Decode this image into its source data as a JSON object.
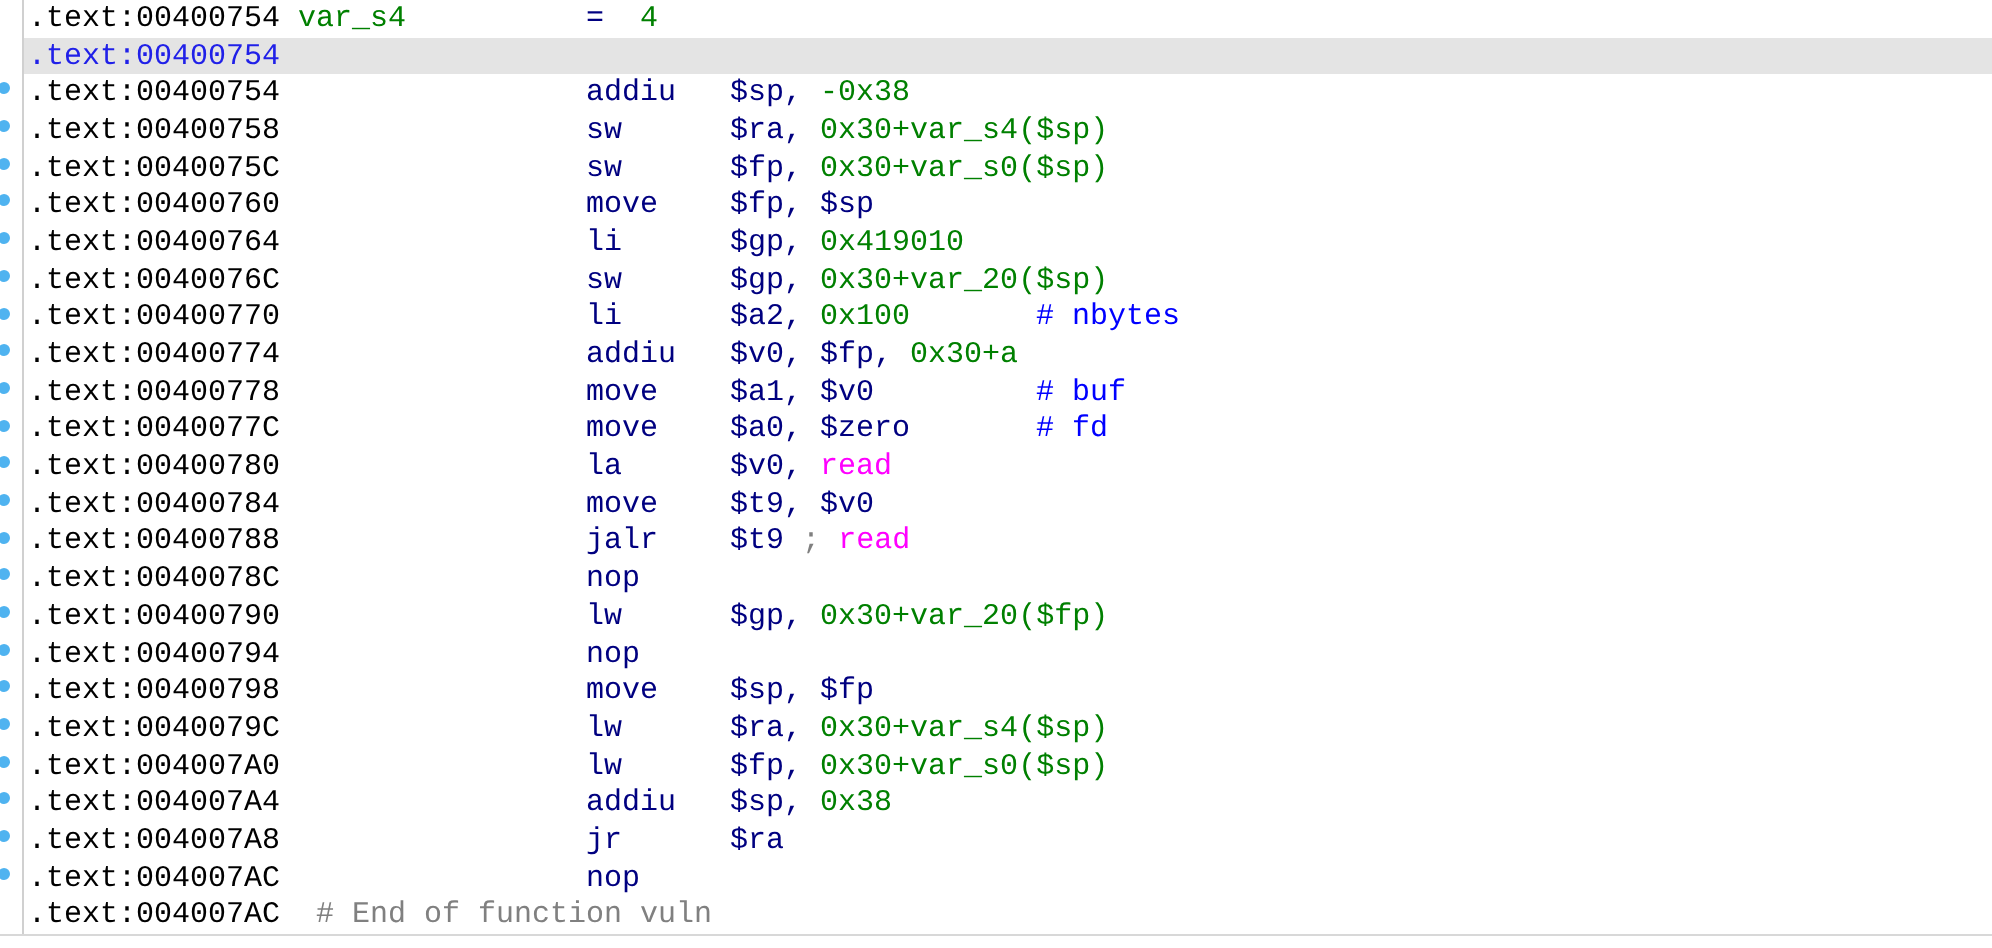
{
  "rows": [
    {
      "kind": "stackvar",
      "address": ".text:00400754",
      "selected": false,
      "name": "var_s4",
      "operator": "=",
      "value": "4"
    },
    {
      "kind": "label",
      "address": ".text:00400754",
      "selected": true
    },
    {
      "kind": "instruction",
      "address": ".text:00400754",
      "selected": false,
      "mnemonic": "addiu",
      "operands": [
        {
          "text": "$sp, ",
          "kind": "reg"
        },
        {
          "text": "-0x38",
          "kind": "num"
        }
      ]
    },
    {
      "kind": "instruction",
      "address": ".text:00400758",
      "selected": false,
      "mnemonic": "sw",
      "operands": [
        {
          "text": "$ra, ",
          "kind": "reg"
        },
        {
          "text": "0x30+var_s4($sp)",
          "kind": "num"
        }
      ]
    },
    {
      "kind": "instruction",
      "address": ".text:0040075C",
      "selected": false,
      "mnemonic": "sw",
      "operands": [
        {
          "text": "$fp, ",
          "kind": "reg"
        },
        {
          "text": "0x30+var_s0($sp)",
          "kind": "num"
        }
      ]
    },
    {
      "kind": "instruction",
      "address": ".text:00400760",
      "selected": false,
      "mnemonic": "move",
      "operands": [
        {
          "text": "$fp, $sp",
          "kind": "reg"
        }
      ]
    },
    {
      "kind": "instruction",
      "address": ".text:00400764",
      "selected": false,
      "mnemonic": "li",
      "operands": [
        {
          "text": "$gp, ",
          "kind": "reg"
        },
        {
          "text": "0x419010",
          "kind": "num"
        }
      ]
    },
    {
      "kind": "instruction",
      "address": ".text:0040076C",
      "selected": false,
      "mnemonic": "sw",
      "operands": [
        {
          "text": "$gp, ",
          "kind": "reg"
        },
        {
          "text": "0x30+var_20($sp)",
          "kind": "num"
        }
      ]
    },
    {
      "kind": "instruction",
      "address": ".text:00400770",
      "selected": false,
      "mnemonic": "li",
      "operands": [
        {
          "text": "$a2, ",
          "kind": "reg"
        },
        {
          "text": "0x100",
          "kind": "num"
        }
      ],
      "comment": "# nbytes"
    },
    {
      "kind": "instruction",
      "address": ".text:00400774",
      "selected": false,
      "mnemonic": "addiu",
      "operands": [
        {
          "text": "$v0, $fp, ",
          "kind": "reg"
        },
        {
          "text": "0x30+a",
          "kind": "num"
        }
      ]
    },
    {
      "kind": "instruction",
      "address": ".text:00400778",
      "selected": false,
      "mnemonic": "move",
      "operands": [
        {
          "text": "$a1, $v0",
          "kind": "reg"
        }
      ],
      "comment": "# buf"
    },
    {
      "kind": "instruction",
      "address": ".text:0040077C",
      "selected": false,
      "mnemonic": "move",
      "operands": [
        {
          "text": "$a0, $zero",
          "kind": "reg"
        }
      ],
      "comment": "# fd"
    },
    {
      "kind": "instruction",
      "address": ".text:00400780",
      "selected": false,
      "mnemonic": "la",
      "operands": [
        {
          "text": "$v0, ",
          "kind": "reg"
        },
        {
          "text": "read",
          "kind": "import"
        }
      ]
    },
    {
      "kind": "instruction",
      "address": ".text:00400784",
      "selected": false,
      "mnemonic": "move",
      "operands": [
        {
          "text": "$t9, $v0",
          "kind": "reg"
        }
      ]
    },
    {
      "kind": "instruction",
      "address": ".text:00400788",
      "selected": false,
      "mnemonic": "jalr",
      "operands": [
        {
          "text": "$t9",
          "kind": "reg"
        },
        {
          "text": " ; ",
          "kind": "sep"
        },
        {
          "text": "read",
          "kind": "import"
        }
      ]
    },
    {
      "kind": "instruction",
      "address": ".text:0040078C",
      "selected": false,
      "mnemonic": "nop"
    },
    {
      "kind": "instruction",
      "address": ".text:00400790",
      "selected": false,
      "mnemonic": "lw",
      "operands": [
        {
          "text": "$gp, ",
          "kind": "reg"
        },
        {
          "text": "0x30+var_20($fp)",
          "kind": "num"
        }
      ]
    },
    {
      "kind": "instruction",
      "address": ".text:00400794",
      "selected": false,
      "mnemonic": "nop"
    },
    {
      "kind": "instruction",
      "address": ".text:00400798",
      "selected": false,
      "mnemonic": "move",
      "operands": [
        {
          "text": "$sp, $fp",
          "kind": "reg"
        }
      ]
    },
    {
      "kind": "instruction",
      "address": ".text:0040079C",
      "selected": false,
      "mnemonic": "lw",
      "operands": [
        {
          "text": "$ra, ",
          "kind": "reg"
        },
        {
          "text": "0x30+var_s4($sp)",
          "kind": "num"
        }
      ]
    },
    {
      "kind": "instruction",
      "address": ".text:004007A0",
      "selected": false,
      "mnemonic": "lw",
      "operands": [
        {
          "text": "$fp, ",
          "kind": "reg"
        },
        {
          "text": "0x30+var_s0($sp)",
          "kind": "num"
        }
      ]
    },
    {
      "kind": "instruction",
      "address": ".text:004007A4",
      "selected": false,
      "mnemonic": "addiu",
      "operands": [
        {
          "text": "$sp, ",
          "kind": "reg"
        },
        {
          "text": "0x38",
          "kind": "num"
        }
      ]
    },
    {
      "kind": "instruction",
      "address": ".text:004007A8",
      "selected": false,
      "mnemonic": "jr",
      "operands": [
        {
          "text": "$ra",
          "kind": "reg"
        }
      ]
    },
    {
      "kind": "instruction",
      "address": ".text:004007AC",
      "selected": false,
      "mnemonic": "nop"
    },
    {
      "kind": "comment",
      "address": ".text:004007AC",
      "selected": false,
      "comment": "# End of function vuln"
    }
  ]
}
